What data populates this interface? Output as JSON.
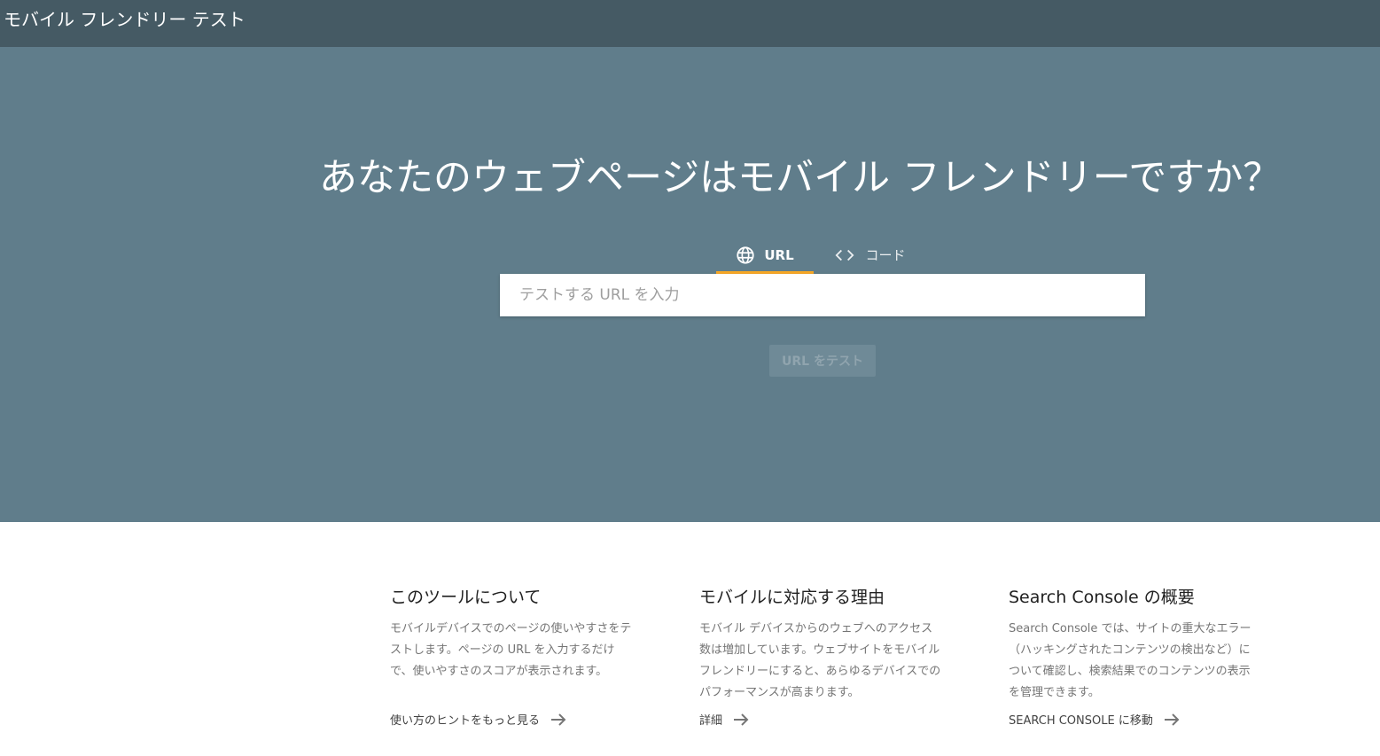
{
  "header": {
    "title": "モバイル フレンドリー テスト"
  },
  "hero": {
    "headline": "あなたのウェブページはモバイル フレンドリーですか？",
    "tabs": [
      {
        "label": "URL",
        "icon": "globe-icon",
        "selected": true
      },
      {
        "label": "コード",
        "icon": "code-icon",
        "selected": false
      }
    ],
    "search": {
      "value": "",
      "placeholder": "テストする URL を入力"
    },
    "test_button_label": "URL をテスト"
  },
  "info": [
    {
      "title": "このツールについて",
      "body": "モバイルデバイスでのページの使いやすさをテストします。ページの URL を入力するだけで、使いやすさのスコアが表示されます。",
      "link": "使い方のヒントをもっと見る"
    },
    {
      "title": "モバイルに対応する理由",
      "body": "モバイル デバイスからのウェブへのアクセス数は増加しています。ウェブサイトをモバイル フレンドリーにすると、あらゆるデバイスでのパフォーマンスが高まります。",
      "link": "詳細"
    },
    {
      "title": "Search Console の概要",
      "body": "Search Console では、サイトの重大なエラー（ハッキングされたコンテンツの検出など）について確認し、検索結果でのコンテンツの表示を管理できます。",
      "link": "SEARCH CONSOLE に移動"
    }
  ],
  "colors": {
    "topbar": "#455a64",
    "hero": "#607d8b",
    "tab_indicator": "#f9a825",
    "button_disabled": "#6f8a97"
  }
}
